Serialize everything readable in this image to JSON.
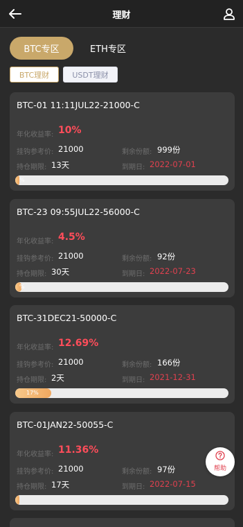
{
  "header": {
    "title": "理财"
  },
  "zone_tabs": [
    {
      "label": "BTC专区"
    },
    {
      "label": "ETH专区"
    }
  ],
  "sub_tabs": [
    {
      "label": "BTC理财"
    },
    {
      "label": "USDT理财"
    }
  ],
  "labels": {
    "yield": "年化收益率:",
    "ref_price": "挂钩参考价:",
    "remaining": "剩余份额:",
    "period": "持仓期限:",
    "due": "到期日:"
  },
  "colors": {
    "accent": "#c9a86a",
    "red": "#e0414f",
    "background": "#2b2b2b",
    "card": "#3c3c3c"
  },
  "products": [
    {
      "title": "BTC-01 11:11JUL22-21000-C",
      "yield": "10%",
      "ref_price": "21000",
      "remaining": "999份",
      "period": "13天",
      "due": "2022-07-01",
      "progress": 0.02,
      "progress_text": "%"
    },
    {
      "title": "BTC-23 09:55JUL22-56000-C",
      "yield": "4.5%",
      "ref_price": "21000",
      "remaining": "92份",
      "period": "30天",
      "due": "2022-07-23",
      "progress": 0.03,
      "progress_text": "%"
    },
    {
      "title": "BTC-31DEC21-50000-C",
      "yield": "12.69%",
      "ref_price": "21000",
      "remaining": "166份",
      "period": "2天",
      "due": "2021-12-31",
      "progress": 0.17,
      "progress_text": "17%"
    },
    {
      "title": "BTC-01JAN22-50055-C",
      "yield": "11.36%",
      "ref_price": "21000",
      "remaining": "97份",
      "period": "17天",
      "due": "2022-07-15",
      "progress": 0.02,
      "progress_text": ""
    }
  ],
  "help": {
    "label": "帮助"
  }
}
